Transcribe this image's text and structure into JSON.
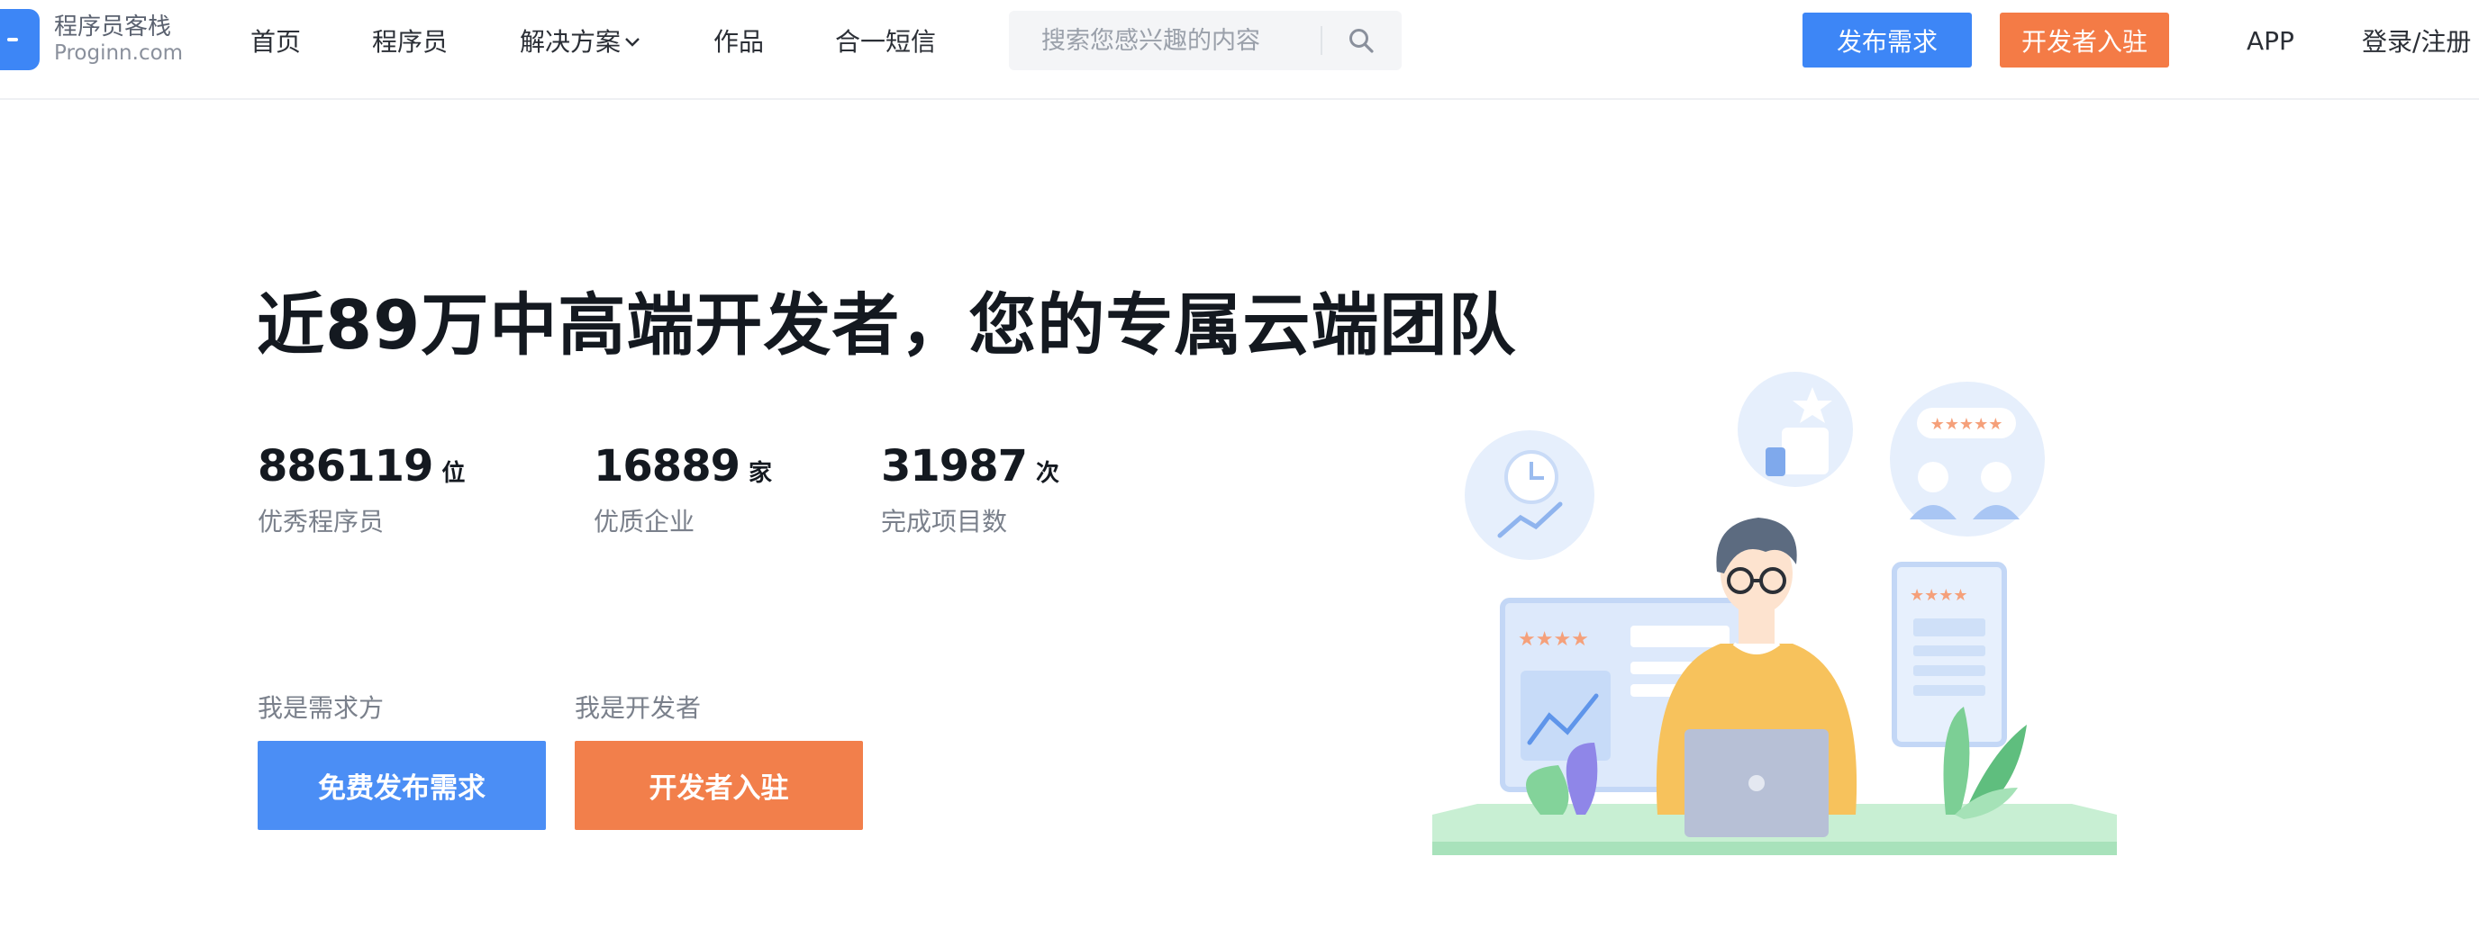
{
  "header": {
    "logo_cn": "程序员客栈",
    "logo_en": "Proginn.com",
    "nav": {
      "home": "首页",
      "programmers": "程序员",
      "solutions": "解决方案",
      "works": "作品",
      "sms": "合一短信"
    },
    "search_placeholder": "搜索您感兴趣的内容",
    "publish_label": "发布需求",
    "developer_join_label": "开发者入驻",
    "app_label": "APP",
    "login_label": "登录/注册"
  },
  "hero": {
    "title": "近89万中高端开发者，您的专属云端团队",
    "stats": [
      {
        "value": "886119",
        "unit": "位",
        "label": "优秀程序员"
      },
      {
        "value": "16889",
        "unit": "家",
        "label": "优质企业"
      },
      {
        "value": "31987",
        "unit": "次",
        "label": "完成项目数"
      }
    ],
    "demand_side_label": "我是需求方",
    "developer_side_label": "我是开发者",
    "free_publish_label": "免费发布需求",
    "developer_join_label": "开发者入驻"
  },
  "colors": {
    "primary_blue": "#3d86f6",
    "accent_orange": "#f47b46"
  },
  "icons": {
    "solutions_dropdown": "chevron-down-icon",
    "search": "search-icon"
  }
}
